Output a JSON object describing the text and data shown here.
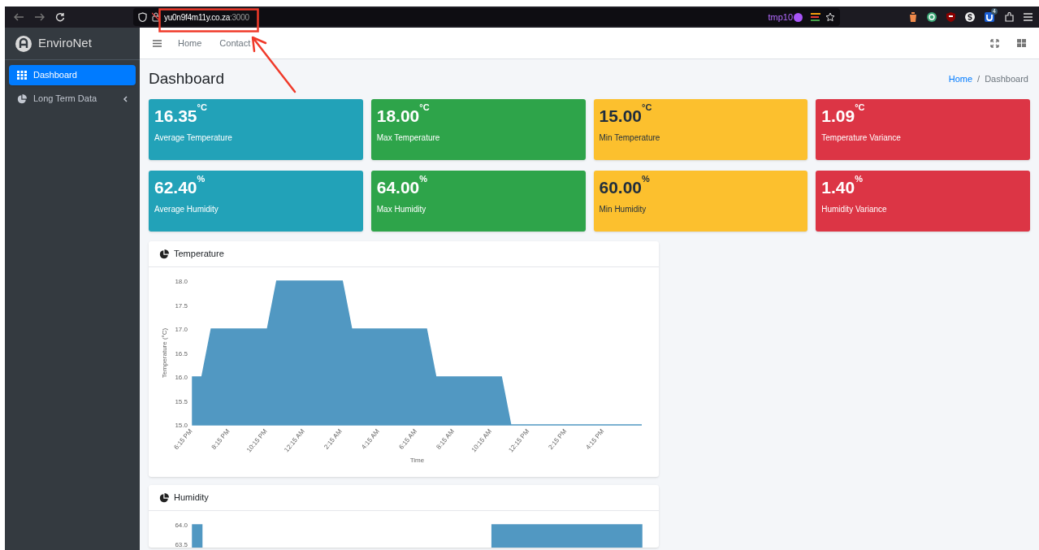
{
  "browser": {
    "url_host": "yu0n9f4m11y.co.za",
    "url_port": ":3000",
    "profile_label": "tmp10",
    "extension_badge": "4"
  },
  "sidebar": {
    "brand": "EnviroNet",
    "items": [
      {
        "label": "Dashboard",
        "selected": true,
        "expandable": false
      },
      {
        "label": "Long Term Data",
        "selected": false,
        "expandable": true
      }
    ]
  },
  "navbar": {
    "links": [
      "Home",
      "Contact"
    ]
  },
  "page": {
    "title": "Dashboard",
    "breadcrumb": [
      {
        "label": "Home",
        "link": true
      },
      {
        "label": "Dashboard",
        "link": false
      }
    ],
    "breadcrumb_separator": "/"
  },
  "stat_cards": [
    {
      "value": "16.35$^{°C}$",
      "label": "Average Temperature",
      "color": "#22a2b8"
    },
    {
      "value": "18.00$^{°C}$",
      "label": "Max Temperature",
      "color": "#2ea44a"
    },
    {
      "value": "15.00$^{°C}$",
      "label": "Min Temperature",
      "color": "#fcc02e"
    },
    {
      "value": "1.09$^{°C}$",
      "label": "Temperature Variance",
      "color": "#dc3545"
    },
    {
      "value": "62.40$^{%}$",
      "label": "Average Humidity",
      "color": "#22a2b8"
    },
    {
      "value": "64.00$^{%}$",
      "label": "Max Humidity",
      "color": "#2ea44a"
    },
    {
      "value": "60.00$^{%}$",
      "label": "Min Humidity",
      "color": "#fcc02e"
    },
    {
      "value": "1.40$^{%}$",
      "label": "Humidity Variance",
      "color": "#dc3545"
    }
  ],
  "charts": [
    {
      "title": "Temperature",
      "chart_data": {
        "type": "area",
        "xlabel": "Time",
        "ylabel": "Temperature (°C)",
        "categories": [
          "6:15 PM",
          null,
          null,
          null,
          "8:15 PM",
          null,
          null,
          null,
          "10:15 PM",
          null,
          null,
          null,
          "12:15 AM",
          null,
          null,
          null,
          "2:15 AM",
          null,
          null,
          null,
          "4:15 AM",
          null,
          null,
          null,
          "6:15 AM",
          null,
          null,
          null,
          "8:15 AM",
          null,
          null,
          null,
          "10:15 AM",
          null,
          null,
          null,
          "12:15 PM",
          null,
          null,
          null,
          "2:15 PM",
          null,
          null,
          null,
          "4:15 PM",
          null,
          null,
          null,
          null
        ],
        "series": [
          {
            "color": "#5198c2",
            "values": [
              16,
              16,
              17,
              17,
              17,
              17,
              17,
              17,
              17,
              18,
              18,
              18,
              18,
              18,
              18,
              18,
              18,
              17,
              17,
              17,
              17,
              17,
              17,
              17,
              17,
              17,
              16,
              16,
              16,
              16,
              16,
              16,
              16,
              16,
              15,
              15,
              15,
              15,
              15,
              15,
              15,
              15,
              15,
              15,
              15,
              15,
              15,
              15,
              15
            ]
          }
        ],
        "ylim": [
          15,
          18
        ],
        "yticks": [
          {
            "value": 15,
            "label": "15.0"
          },
          {
            "value": 15.5,
            "label": "15.5"
          },
          {
            "value": 16,
            "label": "16.0"
          },
          {
            "value": 16.5,
            "label": "16.5"
          },
          {
            "value": 17,
            "label": "17.0"
          },
          {
            "value": 17.5,
            "label": "17.5"
          },
          {
            "value": 18,
            "label": "18.0"
          }
        ]
      }
    },
    {
      "title": "Humidity",
      "chart_data": {
        "type": "area",
        "series": [
          {
            "color": "#5198c2",
            "values": [
              64,
              64,
              null,
              null,
              null,
              null,
              null,
              null,
              null,
              null,
              null,
              null,
              null,
              null,
              null,
              null,
              null,
              null,
              null,
              null,
              null,
              null,
              null,
              null,
              null,
              null,
              null,
              null,
              null,
              null,
              null,
              null,
              64,
              64,
              64,
              64,
              64,
              64,
              64,
              64,
              64,
              64,
              64,
              64,
              64,
              64,
              64,
              64,
              64
            ]
          }
        ],
        "ylim": [
          63.5,
          64
        ],
        "yticks": [
          {
            "value": 63.5,
            "label": "63.5"
          },
          {
            "value": 64,
            "label": "64.0"
          }
        ]
      }
    }
  ]
}
